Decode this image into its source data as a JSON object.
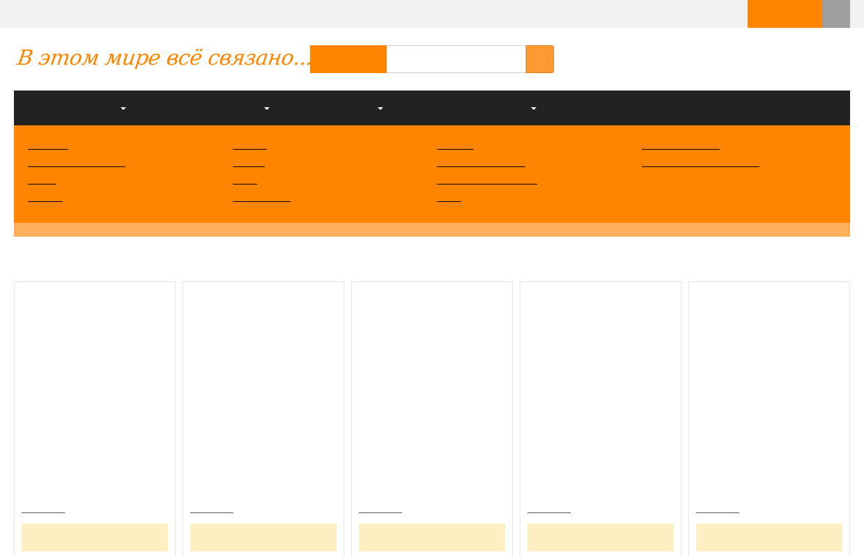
{
  "topbar": {
    "login_label": "",
    "cart_label": ""
  },
  "header": {
    "logo_text": "В этом мире всё связано..."
  },
  "search": {
    "category_label": "",
    "placeholder": "",
    "value": ""
  },
  "navbar": {
    "items": [
      {
        "label": "",
        "has_dropdown": true
      },
      {
        "label": "",
        "has_dropdown": true
      },
      {
        "label": "",
        "has_dropdown": true
      },
      {
        "label": "",
        "has_dropdown": true
      }
    ]
  },
  "mega_menu": {
    "columns": [
      {
        "links": [
          "",
          "",
          "",
          ""
        ]
      },
      {
        "links": [
          "",
          "",
          "",
          ""
        ]
      },
      {
        "links": [
          "",
          "",
          "",
          ""
        ]
      },
      {
        "links": [
          "",
          ""
        ]
      }
    ]
  },
  "products": [
    {
      "title": "",
      "button_label": ""
    },
    {
      "title": "",
      "button_label": ""
    },
    {
      "title": "",
      "button_label": ""
    },
    {
      "title": "",
      "button_label": ""
    },
    {
      "title": "",
      "button_label": ""
    }
  ],
  "colors": {
    "accent": "#ff8400",
    "accent_light": "#ffb05c",
    "nav_background": "#222222",
    "button_soft": "#fdefc2"
  }
}
